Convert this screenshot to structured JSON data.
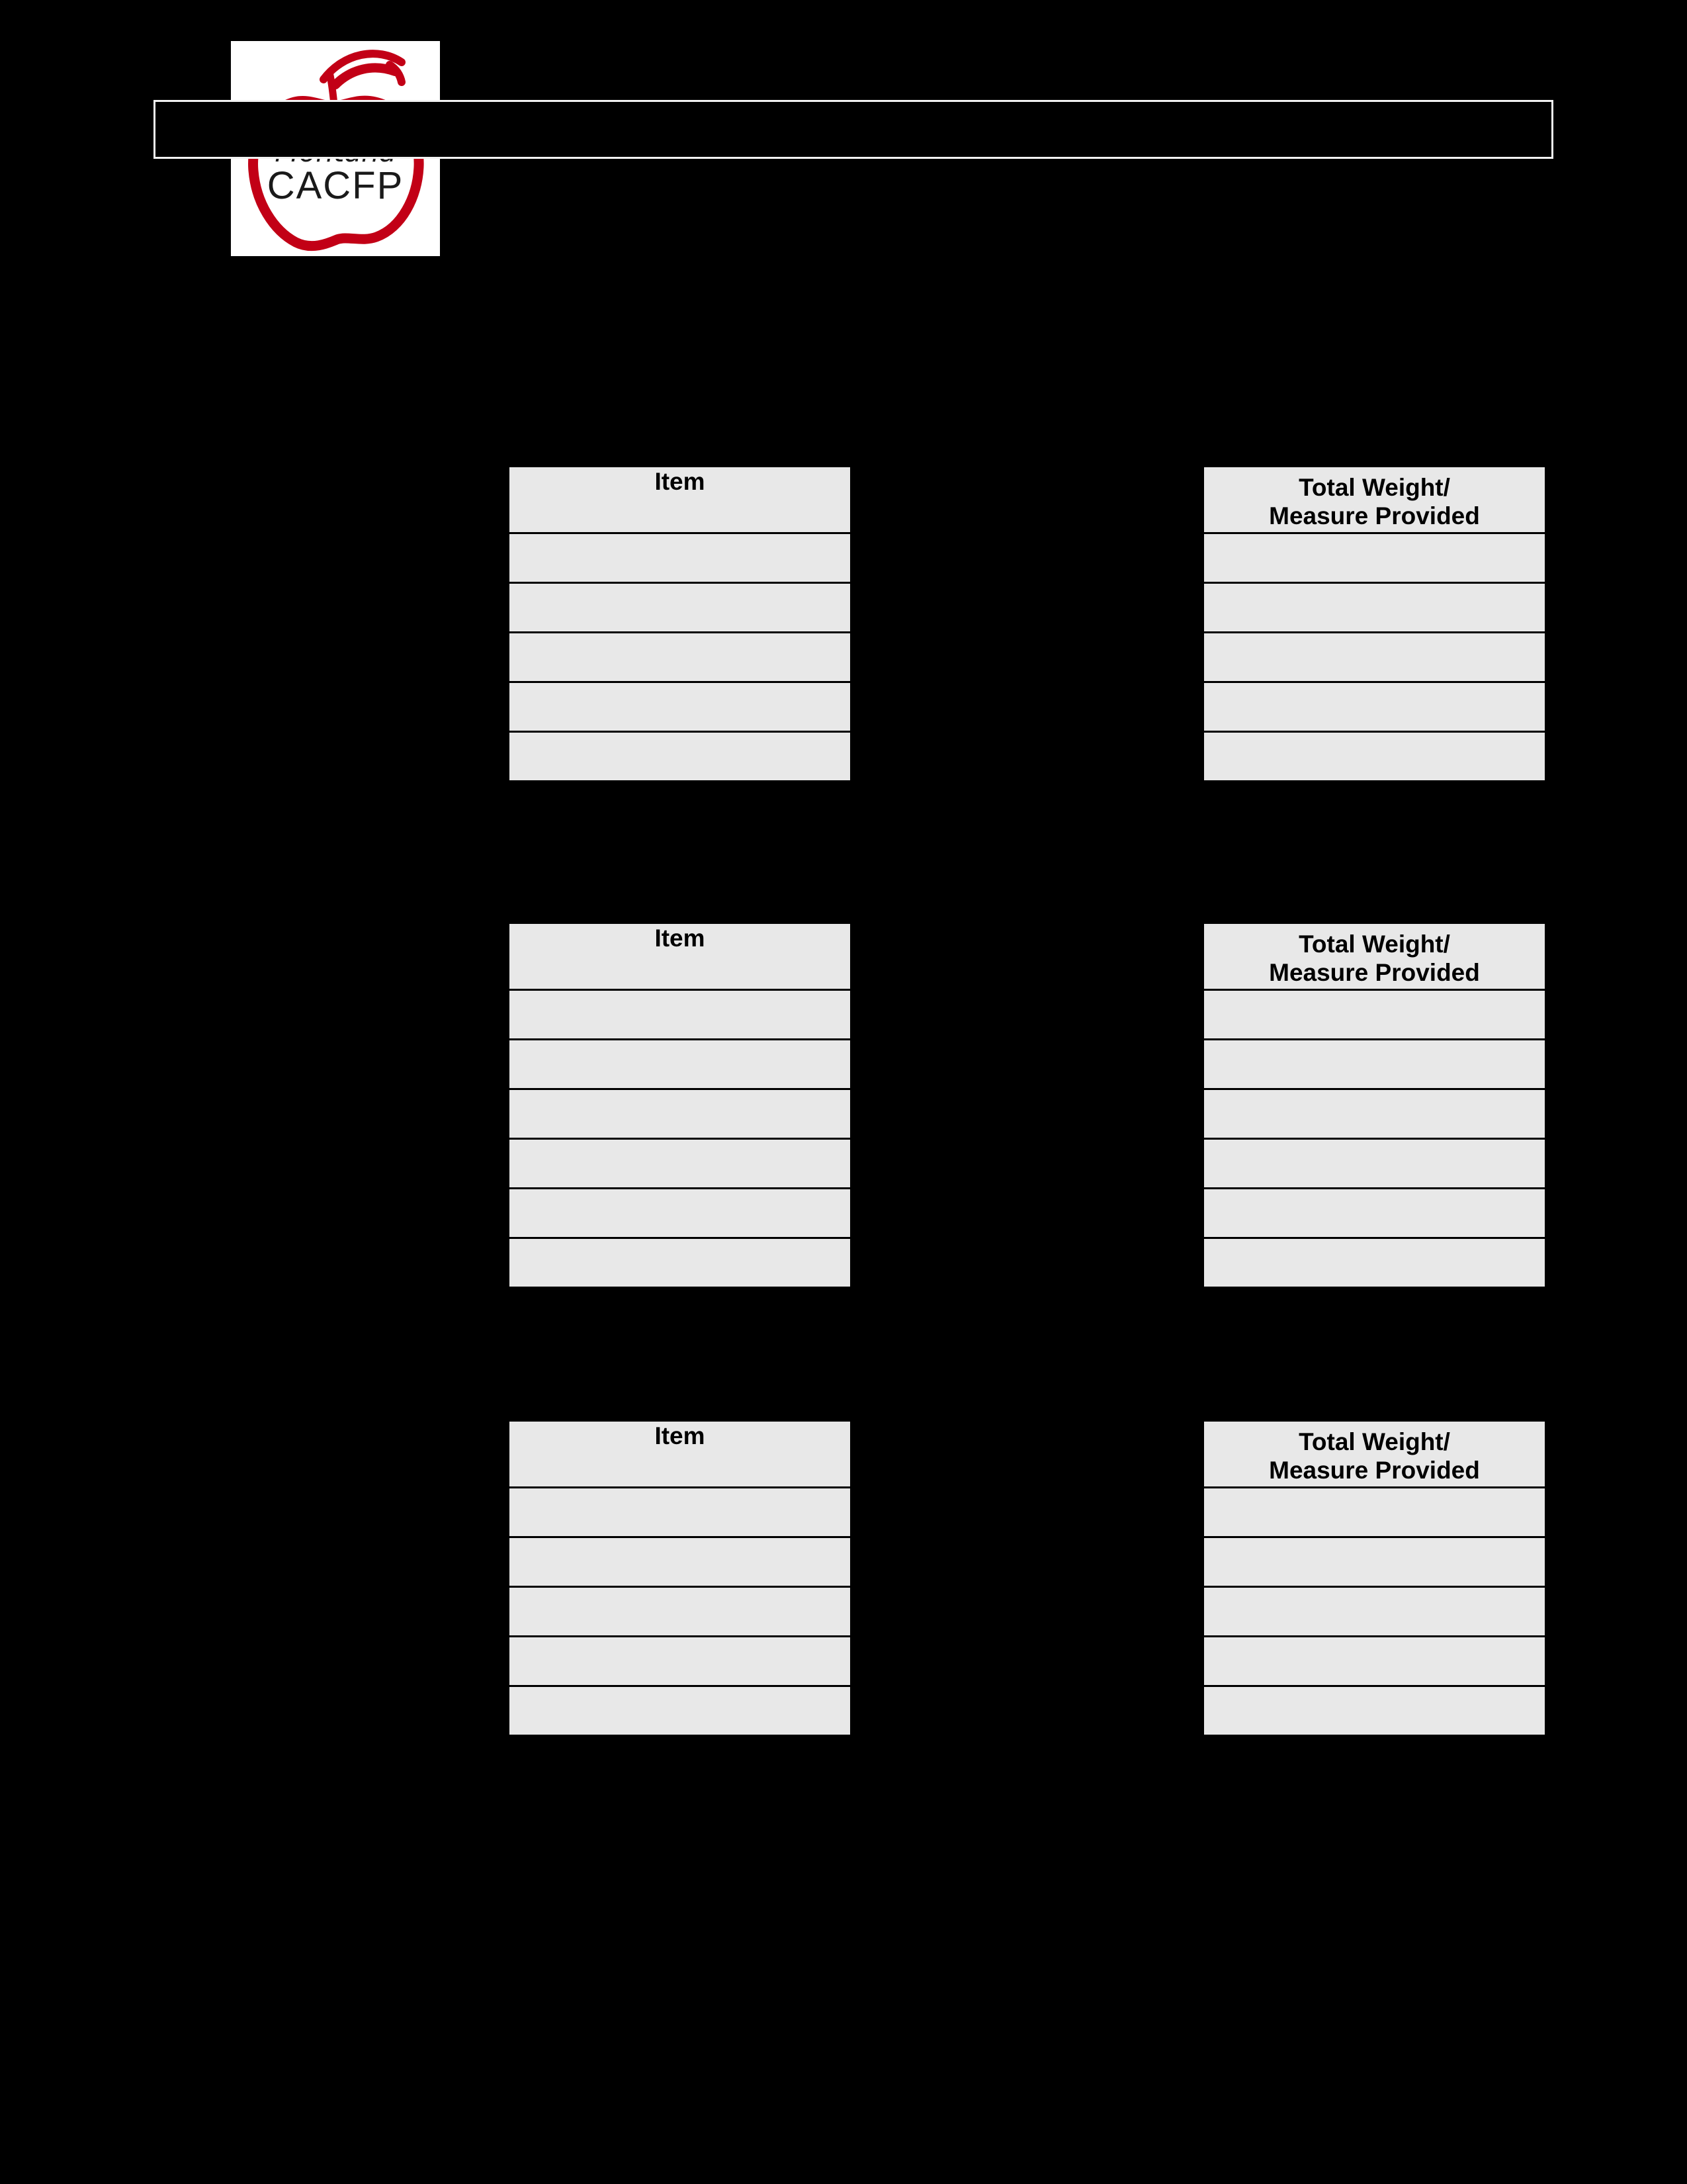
{
  "page": {
    "background_color": "#000000",
    "cell_fill_color": "#e8e8e8",
    "border_color": "#000000",
    "accent_color": "#c8102e"
  },
  "logo": {
    "icon": "apple-logo-icon",
    "script_text": "Montana",
    "acronym_text": "CACFP",
    "apple_color": "#c20016",
    "text_color": "#1a1a1a",
    "background_color": "#ffffff"
  },
  "header_bar": {
    "title": "",
    "border_color": "#f2f2f2",
    "fill_color": "#000000"
  },
  "tables": [
    {
      "id": "table-1",
      "columns": [
        {
          "key": "item",
          "header_lines": [
            "Item"
          ]
        },
        {
          "key": "measure",
          "header_lines": [
            "Total Weight/",
            "Measure Provided"
          ]
        }
      ],
      "rows": [
        {
          "item": "",
          "measure": ""
        },
        {
          "item": "",
          "measure": ""
        },
        {
          "item": "",
          "measure": ""
        },
        {
          "item": "",
          "measure": ""
        },
        {
          "item": "",
          "measure": ""
        }
      ]
    },
    {
      "id": "table-2",
      "columns": [
        {
          "key": "item",
          "header_lines": [
            "Item"
          ]
        },
        {
          "key": "measure",
          "header_lines": [
            "Total Weight/",
            "Measure Provided"
          ]
        }
      ],
      "rows": [
        {
          "item": "",
          "measure": ""
        },
        {
          "item": "",
          "measure": ""
        },
        {
          "item": "",
          "measure": ""
        },
        {
          "item": "",
          "measure": ""
        },
        {
          "item": "",
          "measure": ""
        },
        {
          "item": "",
          "measure": ""
        }
      ]
    },
    {
      "id": "table-3",
      "columns": [
        {
          "key": "item",
          "header_lines": [
            "Item"
          ]
        },
        {
          "key": "measure",
          "header_lines": [
            "Total Weight/",
            "Measure Provided"
          ]
        }
      ],
      "rows": [
        {
          "item": "",
          "measure": ""
        },
        {
          "item": "",
          "measure": ""
        },
        {
          "item": "",
          "measure": ""
        },
        {
          "item": "",
          "measure": ""
        },
        {
          "item": "",
          "measure": ""
        }
      ]
    }
  ]
}
